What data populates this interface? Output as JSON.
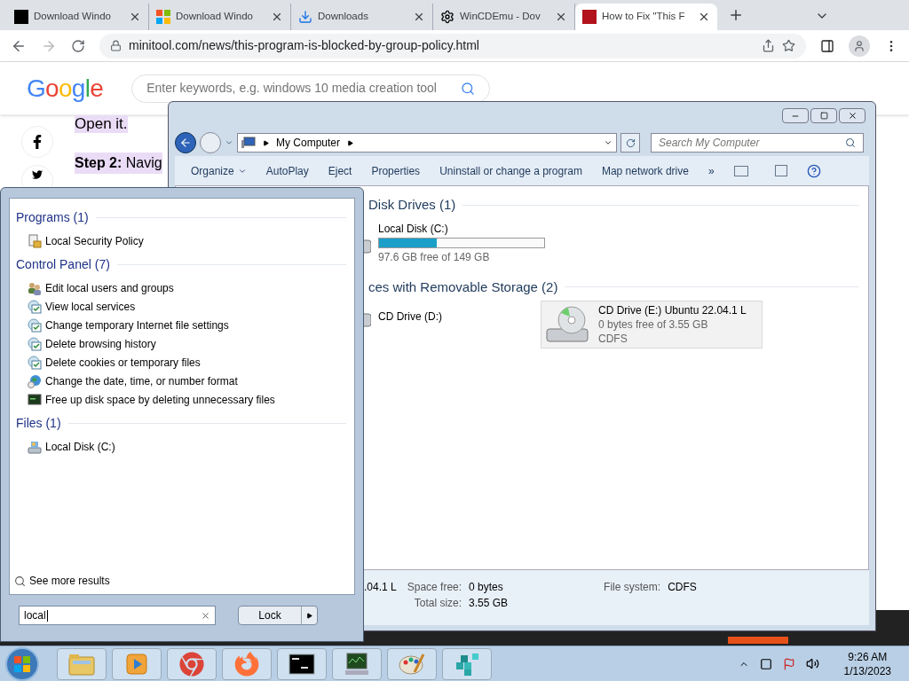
{
  "browser": {
    "tabs": [
      {
        "title": "Download Windo",
        "kind": "black-square",
        "selected": false
      },
      {
        "title": "Download Windo",
        "kind": "four-squares",
        "selected": false
      },
      {
        "title": "Downloads",
        "kind": "download",
        "selected": false
      },
      {
        "title": "WinCDEmu - Dov",
        "kind": "gear",
        "selected": false
      },
      {
        "title": "How to Fix \"This F",
        "kind": "red-square",
        "selected": true
      }
    ],
    "address": "minitool.com/news/this-program-is-blocked-by-group-policy.html",
    "logo": "Google",
    "search_placeholder": "Enter keywords, e.g. windows 10 media creation tool",
    "article": [
      {
        "kind": "cut",
        "text": "Open it."
      },
      {
        "kind": "step",
        "text": "**Step 2:** Navig"
      }
    ]
  },
  "explorer": {
    "breadcrumb": "My Computer",
    "search_placeholder": "Search My Computer",
    "toolbar": [
      {
        "label": "Organize",
        "menu": true
      },
      {
        "label": "AutoPlay",
        "menu": false
      },
      {
        "label": "Eject",
        "menu": false
      },
      {
        "label": "Properties",
        "menu": false
      },
      {
        "label": "Uninstall or change a program",
        "menu": false
      },
      {
        "label": "Map network drive",
        "menu": false
      }
    ],
    "overflow": "»",
    "groups": [
      {
        "title": "Disk Drives (1)",
        "items": [
          {
            "kind": "disk",
            "name": "Local Disk (C:)",
            "level": 0.35,
            "free": "97.6 GB free of 149 GB",
            "selected": false
          }
        ]
      },
      {
        "title": "ces with Removable Storage (2)",
        "items": [
          {
            "kind": "cd",
            "name": "CD Drive (D:)",
            "selected": false
          },
          {
            "kind": "cd",
            "name": "CD Drive (E:) Ubuntu 22.04.1 L",
            "free": "0 bytes free of 3.55 GB",
            "fs": "CDFS",
            "selected": true
          }
        ]
      }
    ],
    "details": {
      "name": ".04.1 L",
      "rows": [
        {
          "label": "Space free:",
          "value": "0 bytes"
        },
        {
          "label": "Total size:",
          "value": "3.55 GB"
        }
      ],
      "side": {
        "label": "File system:",
        "value": "CDFS"
      }
    }
  },
  "start_menu": {
    "sections": [
      {
        "title": "Programs (1)",
        "items": [
          {
            "label": "Local Security Policy",
            "kind": "lock"
          }
        ]
      },
      {
        "title": "Control Panel (7)",
        "items": [
          {
            "label": "Edit local users and groups",
            "kind": "users"
          },
          {
            "label": "View local services",
            "kind": "check"
          },
          {
            "label": "Change temporary Internet file settings",
            "kind": "check"
          },
          {
            "label": "Delete browsing history",
            "kind": "check"
          },
          {
            "label": "Delete cookies or temporary files",
            "kind": "check"
          },
          {
            "label": "Change the date, time, or number format",
            "kind": "globe"
          },
          {
            "label": "Free up disk space by deleting unnecessary files",
            "kind": "screen"
          }
        ]
      },
      {
        "title": "Files (1)",
        "items": [
          {
            "label": "Local Disk (C:)",
            "kind": "disk"
          }
        ]
      }
    ],
    "see_more": "See more results",
    "search_value": "local",
    "lock": "Lock"
  },
  "taskbar": {
    "apps": [
      {
        "kind": "folder"
      },
      {
        "kind": "media"
      },
      {
        "kind": "chrome"
      },
      {
        "kind": "firefox"
      },
      {
        "kind": "terminal"
      },
      {
        "kind": "monitor"
      },
      {
        "kind": "paint"
      },
      {
        "kind": "cubes"
      }
    ],
    "time": "9:26 AM",
    "date": "1/13/2023"
  }
}
